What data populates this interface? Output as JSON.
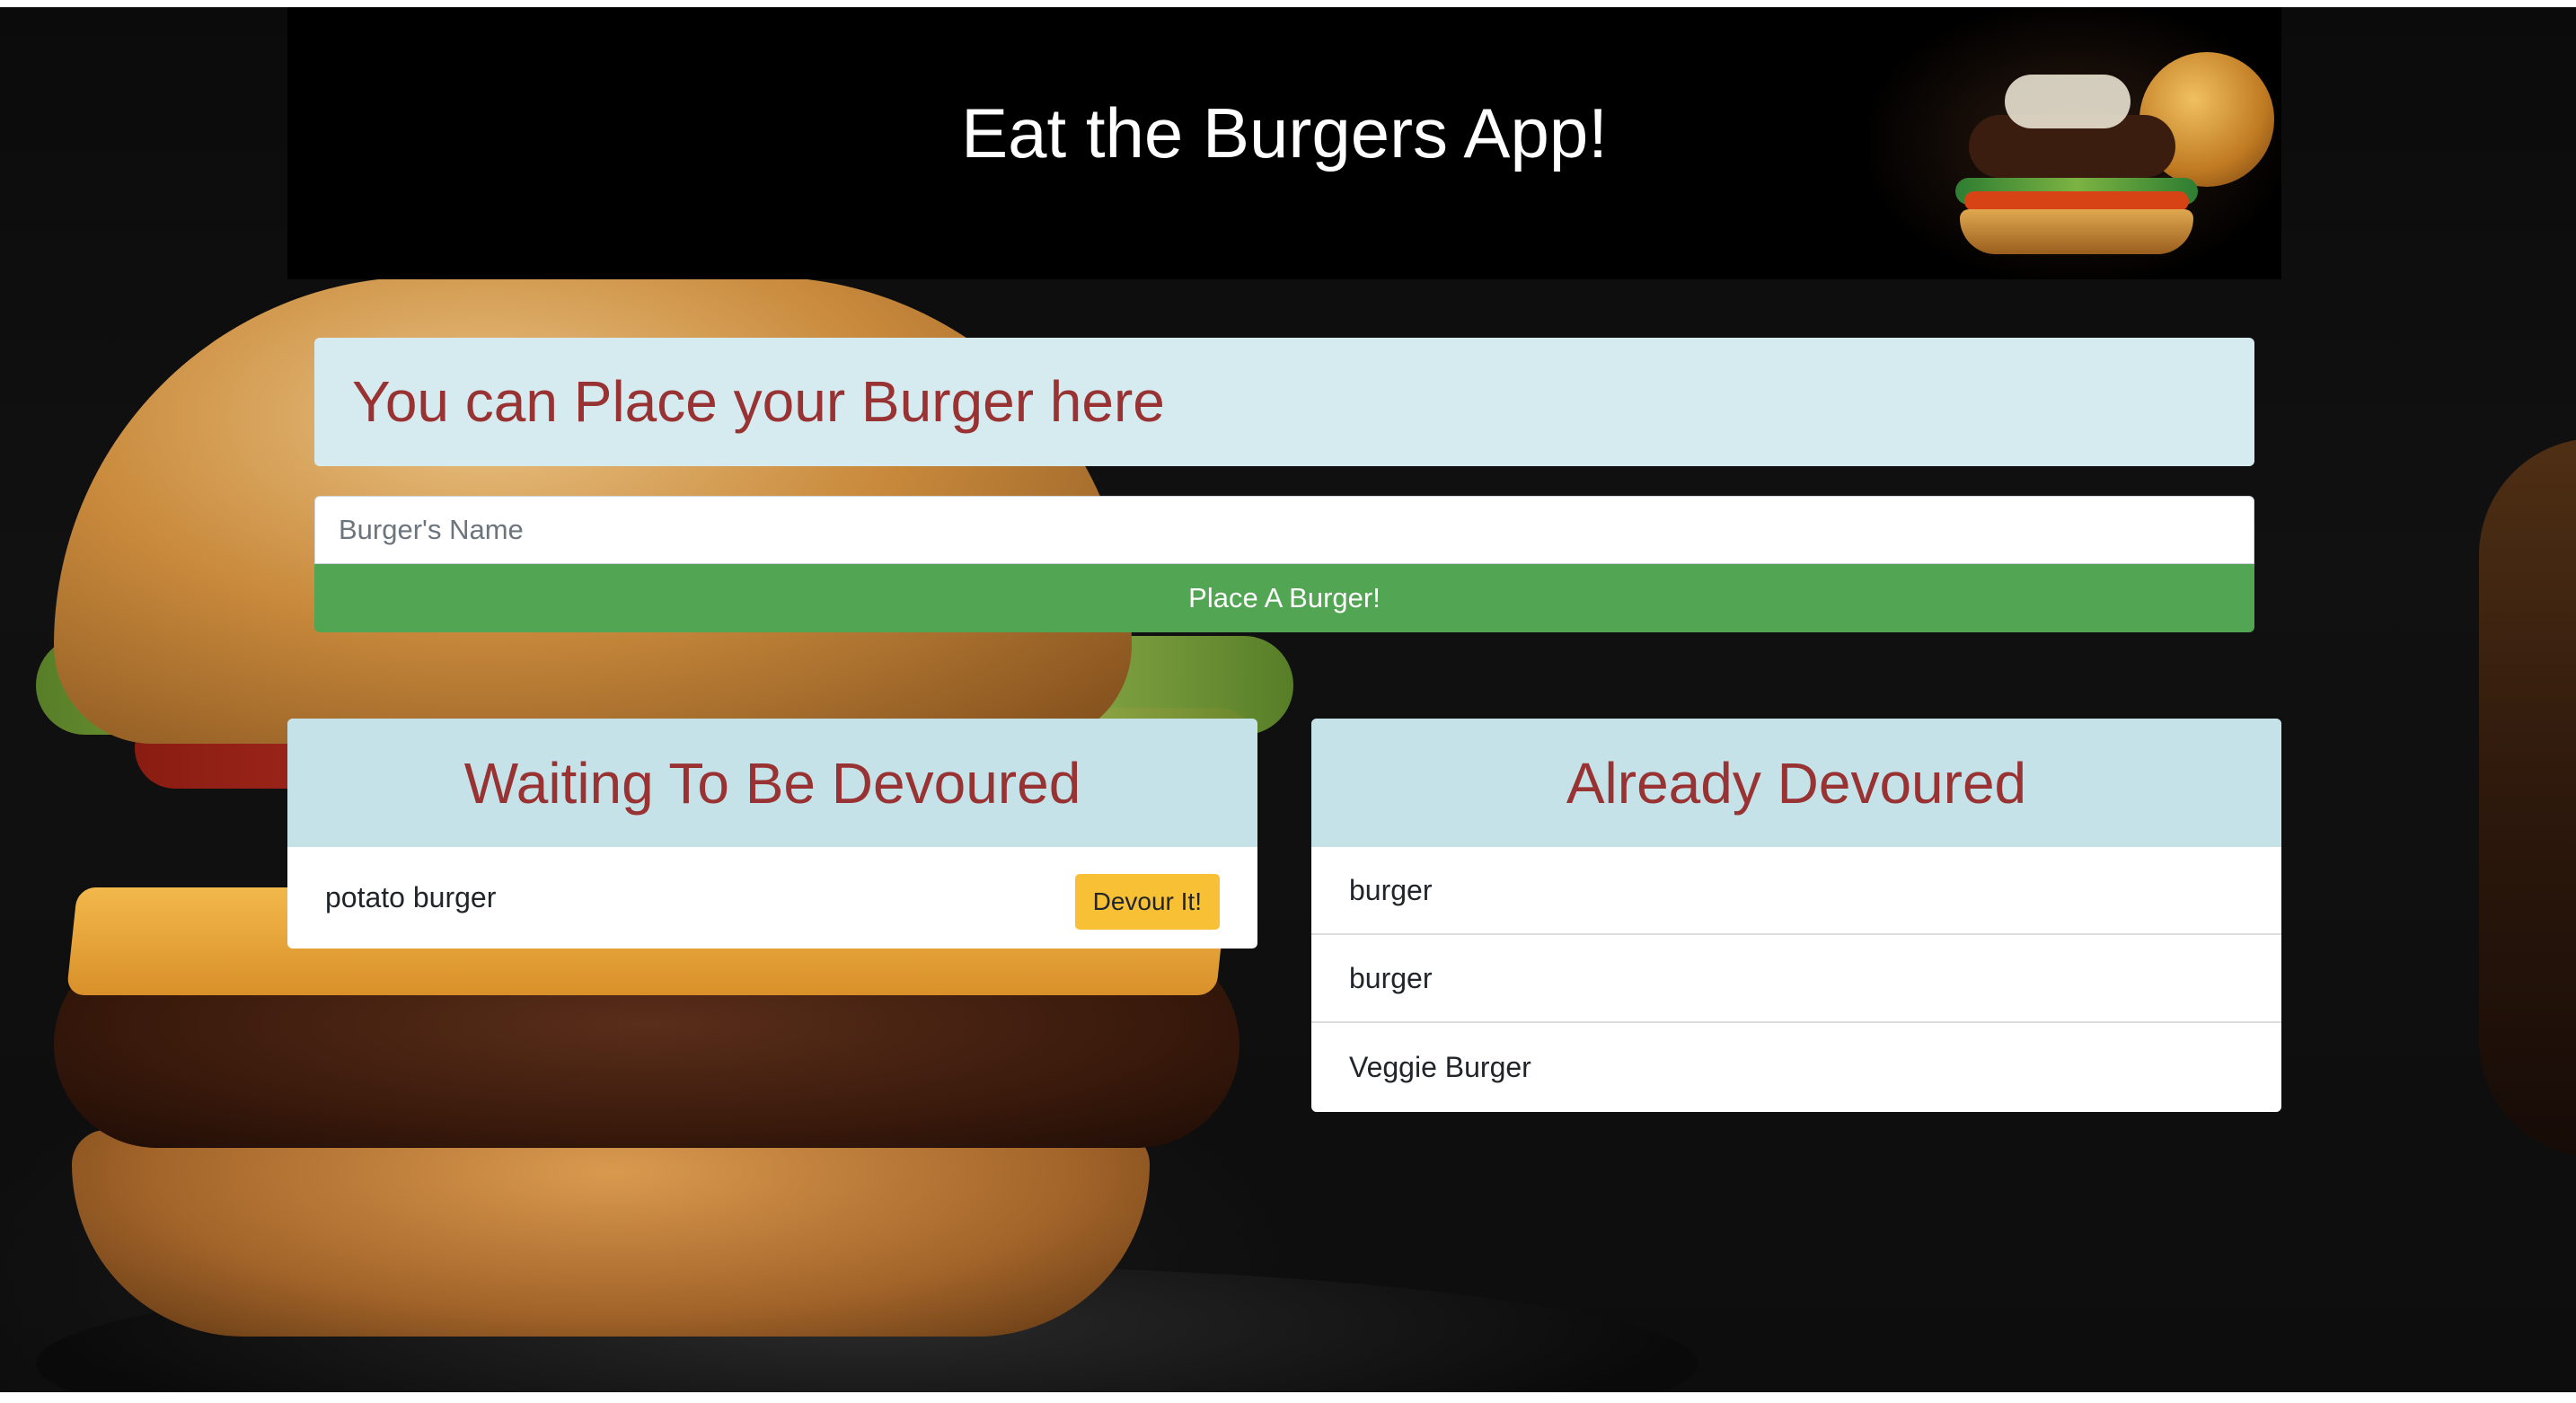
{
  "header": {
    "title": "Eat the Burgers App!"
  },
  "form": {
    "heading": "You can Place your Burger here",
    "input_placeholder": "Burger's Name",
    "input_value": "",
    "submit_label": "Place A Burger!"
  },
  "waiting": {
    "title": "Waiting To Be Devoured",
    "items": [
      {
        "name": "potato burger",
        "action_label": "Devour It!"
      }
    ]
  },
  "devoured": {
    "title": "Already Devoured",
    "items": [
      {
        "name": "burger"
      },
      {
        "name": "burger"
      },
      {
        "name": "Veggie Burger"
      }
    ]
  },
  "colors": {
    "header_bg": "#000000",
    "heading_text": "#993333",
    "jumbotron_bg": "#d6ebf0",
    "card_header_bg": "#c5e2e8",
    "submit_bg": "#52a552",
    "devour_bg": "#f7c035"
  }
}
